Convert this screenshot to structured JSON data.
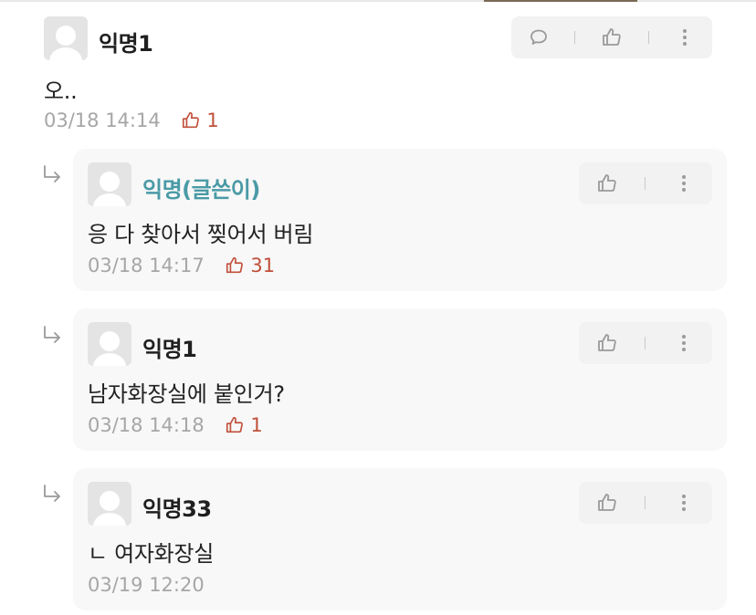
{
  "comments": [
    {
      "name": "익명1",
      "content": "오..",
      "time": "03/18 14:14",
      "likes": "1"
    }
  ],
  "replies": [
    {
      "name": "익명(글쓴이)",
      "content": "응 다 찾아서 찢어서 버림",
      "time": "03/18 14:17",
      "likes": "31"
    },
    {
      "name": "익명1",
      "content": "남자화장실에 붙인거?",
      "time": "03/18 14:18",
      "likes": "1"
    },
    {
      "name": "익명33",
      "content": "ㄴ 여자화장실",
      "time": "03/19 12:20"
    }
  ],
  "colors": {
    "writer_name": "#4a9aa6",
    "like_accent": "#c0503a",
    "meta_gray": "#a6a6a6"
  },
  "icons": [
    "comment-icon",
    "thumbs-up-icon",
    "more-options-icon",
    "reply-arrow-icon",
    "avatar-placeholder"
  ]
}
